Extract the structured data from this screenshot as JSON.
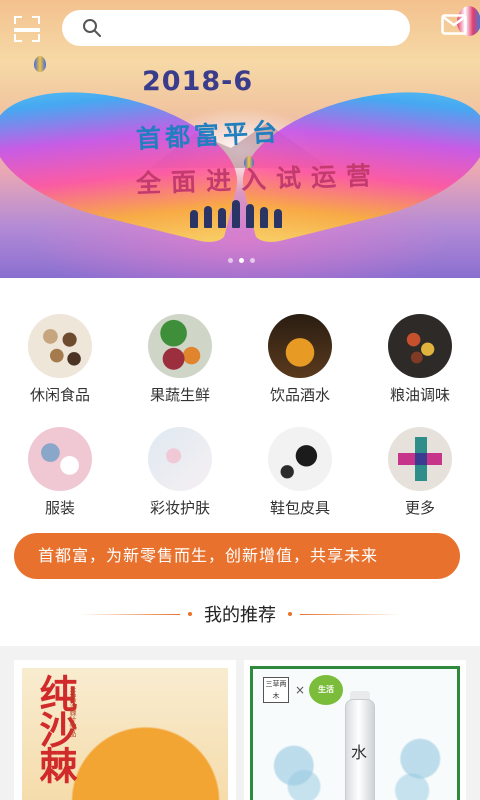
{
  "banner": {
    "date": "2018-6",
    "line1": "首都富平台",
    "line2": "全面进入试运营",
    "slide_count": 3,
    "active_slide": 2
  },
  "topbar": {
    "scan_icon": "scan-icon",
    "search_icon": "search-icon",
    "search_value": "",
    "search_placeholder": "",
    "message_icon": "message-icon"
  },
  "categories": [
    {
      "label": "休闲食品",
      "icon": "snacks-icon"
    },
    {
      "label": "果蔬生鲜",
      "icon": "fresh-produce-icon"
    },
    {
      "label": "饮品酒水",
      "icon": "drinks-icon"
    },
    {
      "label": "粮油调味",
      "icon": "grain-oil-icon"
    },
    {
      "label": "服装",
      "icon": "clothing-icon"
    },
    {
      "label": "彩妆护肤",
      "icon": "cosmetics-icon"
    },
    {
      "label": "鞋包皮具",
      "icon": "shoes-bags-icon"
    },
    {
      "label": "更多",
      "icon": "more-icon"
    }
  ],
  "slogan": "首都富，为新零售而生，创新增值，共享未来",
  "recommend": {
    "title": "我的推荐"
  },
  "products": [
    {
      "title": "纯沙棘",
      "subtitle": "天然沙棘汁饮品"
    },
    {
      "brand_left": "三草两木",
      "brand_right": "生活",
      "label": "水"
    }
  ],
  "colors": {
    "accent": "#e8722d",
    "background": "#ffffff",
    "product_area": "#f2f2f2"
  }
}
